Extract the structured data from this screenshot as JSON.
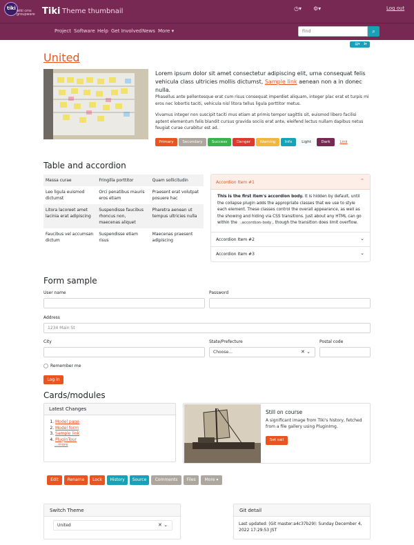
{
  "topbar": {
    "logo_letters": "tiki",
    "logo_caption": "wiki cms groupware",
    "brand": "Tiki",
    "site_title": "Theme thumbnail",
    "clock_icon": "clock-icon",
    "settings_icon": "gear-icon",
    "logout_label": "Log out"
  },
  "nav": {
    "items": [
      "Project",
      "Software",
      "Help",
      "Get Involved",
      "News",
      "More ▾"
    ],
    "search_placeholder": "Find"
  },
  "main": {
    "title": "United",
    "lead_before": "Lorem ipsum dolor sit amet consectetur adipiscing elit, urna consequat felis vehicula class ultricies mollis dictumst, ",
    "lead_link": "Sample link",
    "lead_after": " aenean non a in donec nulla.",
    "para1": "Phasellus ante pellentesque erat cum risus consequat imperdiet aliquam, integer plac erat et turpis mi eros nec lobortis taciti, vehicula nisl litora tellus ligula porttitor metus.",
    "para2": "Vivamus integer non suscipit taciti mus etiam at primis tempor sagittis sit, euismod libero facilisi aptent elementum felis blandit cursus gravida sociis erat ante, eleifend lectus nullam dapibus netus feugiat curae curabitur est ad.",
    "buttons": [
      "Primary",
      "Secondary",
      "Success",
      "Danger",
      "Warning",
      "Info",
      "Light",
      "Dark",
      "Link"
    ]
  },
  "table_section": {
    "heading": "Table and accordion",
    "rows": [
      [
        "Massa curae",
        "Fringilla porttitor",
        "Quam sollicitudin"
      ],
      [
        "Leo ligula euismod dictumst",
        "Orci penatibus mauris eros etiam",
        "Praesent erat volutpat posuere hac"
      ],
      [
        "Litora lacoreet amet lacinia erat adipiscing",
        "Suspendisse faucibus rhoncus non, maecenas aliquet",
        "Pharetra aenean ut tempus ultricies nulla"
      ],
      [
        "Faucibus vel accumsan dictum",
        "Suspendisse etiam risus",
        "Maecenas praesent adipiscing"
      ]
    ]
  },
  "accordion": {
    "item1": "Accordion Item #1",
    "body_bold": "This is the first item's accordion body.",
    "body_text_1": " It is hidden by default, until the collapse plugin adds the appropriate classes that we use to style each element. These classes control the overall appearance, as well as the showing and hiding via CSS transitions. Just about any HTML can go within the ",
    "body_code": ".accordion-body",
    "body_text_2": ", though the transition does limit overflow.",
    "item2": "Accordion Item #2",
    "item3": "Accordion Item #3"
  },
  "form": {
    "heading": "Form sample",
    "username_label": "User name",
    "password_label": "Password",
    "address_label": "Address",
    "address_placeholder": "1234 Main St",
    "city_label": "City",
    "state_label": "State/Prefecture",
    "state_value": "Choose...",
    "postal_label": "Postal code",
    "remember_label": "Remember me",
    "login_label": "Log in"
  },
  "cards": {
    "heading": "Cards/modules",
    "latest_title": "Latest Changes",
    "latest_items": [
      "Model page",
      "Model form",
      "Sample link",
      "PluginTour"
    ],
    "more_label": "...more",
    "card2_title": "Still on course",
    "card2_text": "A significant image from Tiki's history, fetched from a file gallery using PluginImg.",
    "card2_button": "Set sail"
  },
  "actions": {
    "buttons": [
      "Edit",
      "Rename",
      "Lock",
      "History",
      "Source",
      "Comments",
      "Files",
      "More ▾"
    ]
  },
  "switch_theme": {
    "title": "Switch Theme",
    "value": "United"
  },
  "git_detail": {
    "title": "Git detail",
    "text": "Last updated: (Git master:a4c37b29): Sunday December 4, 2022 17:29:53 JST"
  },
  "colors": {
    "brand": "#772953",
    "primary": "#e95420",
    "secondary": "#aea79f",
    "success": "#38b44a",
    "danger": "#df382c",
    "warning": "#efb73e",
    "info": "#17a2b8",
    "dark": "#772953"
  }
}
